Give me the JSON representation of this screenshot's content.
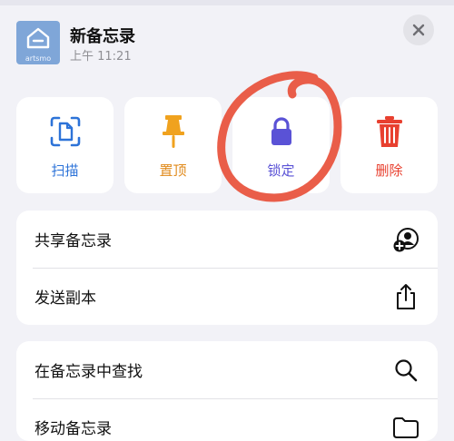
{
  "header": {
    "app_icon_text": "artsmo",
    "title": "新备忘录",
    "subtitle": "上午 11:21"
  },
  "actions": [
    {
      "label": "扫描",
      "icon": "scan-document-icon",
      "color": "#2d73d8"
    },
    {
      "label": "置顶",
      "icon": "pin-icon",
      "color": "#e08a1b"
    },
    {
      "label": "锁定",
      "icon": "lock-icon",
      "color": "#5a52d6"
    },
    {
      "label": "删除",
      "icon": "trash-icon",
      "color": "#e8402f"
    }
  ],
  "menu_group_1": [
    {
      "label": "共享备忘录",
      "icon": "share-person-icon"
    },
    {
      "label": "发送副本",
      "icon": "share-upload-icon"
    }
  ],
  "menu_group_2": [
    {
      "label": "在备忘录中查找",
      "icon": "search-icon"
    },
    {
      "label": "移动备忘录",
      "icon": "folder-icon"
    }
  ],
  "annotation": {
    "color": "#e8503a",
    "shape": "hand-drawn circle around lock action"
  }
}
